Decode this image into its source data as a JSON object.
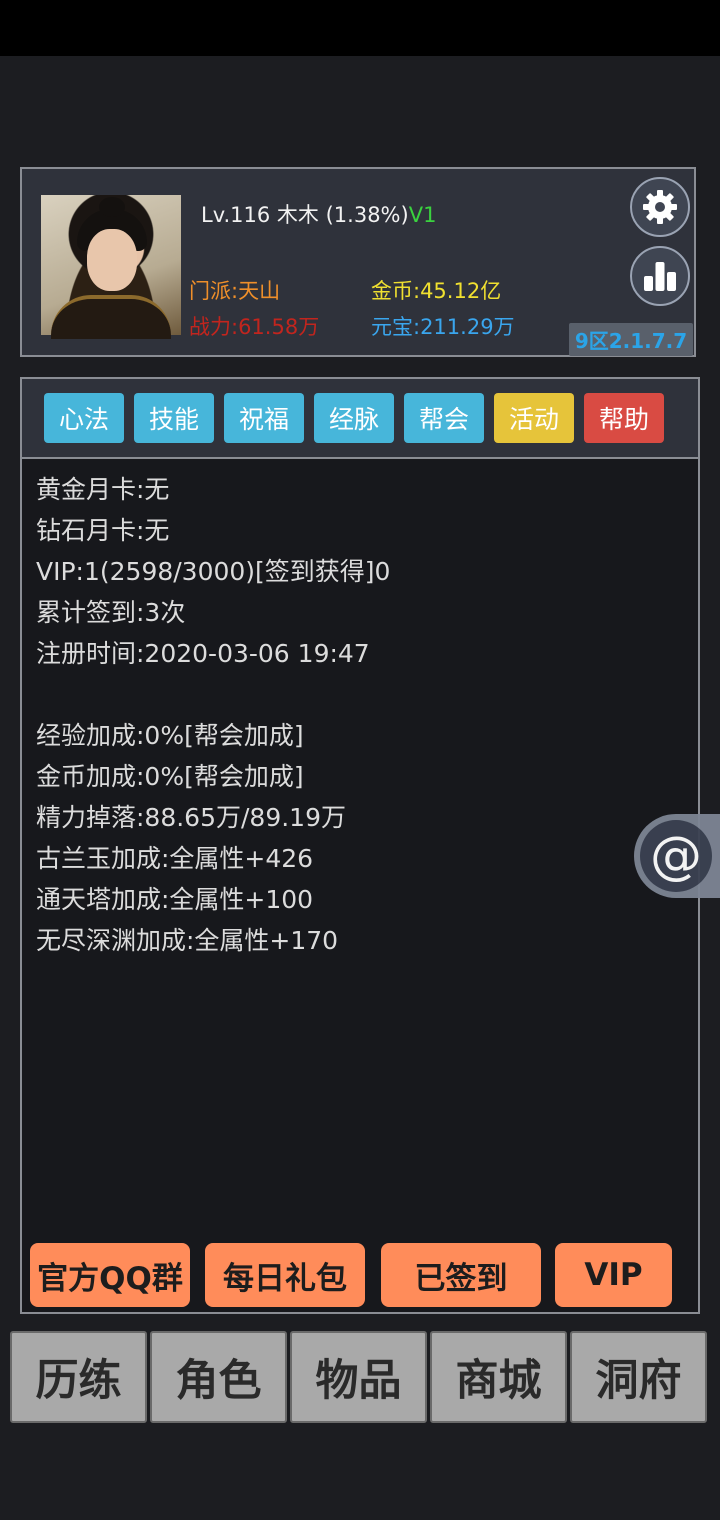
{
  "profile": {
    "level_line": "Lv.116 木木 (1.38%)",
    "vip_tag": "V1",
    "sect": "门派:天山",
    "power": "战力:61.58万",
    "gold": "金币:45.12亿",
    "ingot": "元宝:211.29万",
    "server": "9区2.1.7.7"
  },
  "tabs": [
    {
      "label": "心法",
      "color": "#47b6da"
    },
    {
      "label": "技能",
      "color": "#47b6da"
    },
    {
      "label": "祝福",
      "color": "#47b6da"
    },
    {
      "label": "经脉",
      "color": "#47b6da"
    },
    {
      "label": "帮会",
      "color": "#47b6da"
    },
    {
      "label": "活动",
      "color": "#e6c43a"
    },
    {
      "label": "帮助",
      "color": "#d94b43"
    }
  ],
  "info": {
    "lines_a": [
      "黄金月卡:无",
      "钻石月卡:无",
      "VIP:1(2598/3000)[签到获得]0",
      "累计签到:3次",
      "注册时间:2020-03-06 19:47"
    ],
    "lines_b": [
      "经验加成:0%[帮会加成]",
      "金币加成:0%[帮会加成]",
      "精力掉落:88.65万/89.19万",
      "古兰玉加成:全属性+426",
      "通天塔加成:全属性+100",
      "无尽深渊加成:全属性+170"
    ]
  },
  "actions": [
    "官方QQ群",
    "每日礼包",
    "已签到",
    "VIP"
  ],
  "nav": [
    "历练",
    "角色",
    "物品",
    "商城",
    "洞府"
  ],
  "icons": {
    "settings": "gear-icon",
    "ranking": "bar-chart-icon",
    "mention": "at-icon"
  },
  "floating": {
    "at_symbol": "@"
  }
}
